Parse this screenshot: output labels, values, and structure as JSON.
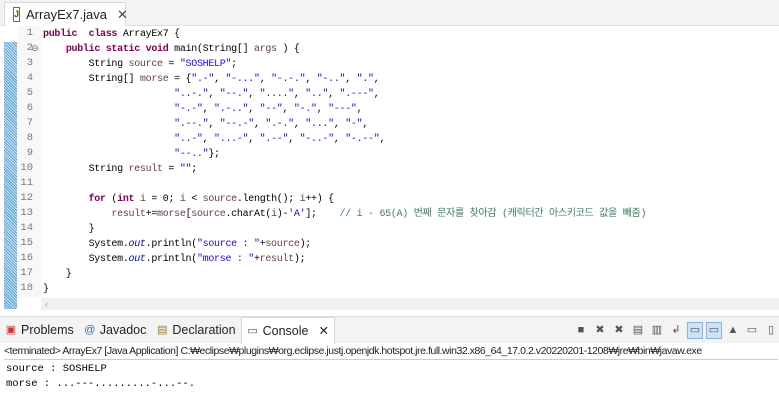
{
  "editor_tab": {
    "title": "ArrayEx7.java",
    "close": "✕"
  },
  "code_lines": [
    [
      [
        "kw",
        "public"
      ],
      [
        "",
        "  "
      ],
      [
        "kw",
        "class"
      ],
      [
        "",
        " ArrayEx7 {"
      ]
    ],
    [
      [
        "",
        "    "
      ],
      [
        "kw",
        "public"
      ],
      [
        "",
        " "
      ],
      [
        "kw",
        "static"
      ],
      [
        "",
        " "
      ],
      [
        "kw",
        "void"
      ],
      [
        "",
        " main(String[] "
      ],
      [
        "var",
        "args"
      ],
      [
        "",
        " ) {"
      ]
    ],
    [
      [
        "",
        "        String "
      ],
      [
        "var",
        "source"
      ],
      [
        "",
        " = "
      ],
      [
        "str",
        "\"SOSHELP\""
      ],
      [
        "",
        ";"
      ]
    ],
    [
      [
        "",
        "        String[] "
      ],
      [
        "var",
        "morse"
      ],
      [
        "",
        " = {"
      ],
      [
        "str",
        "\".-\""
      ],
      [
        "",
        ", "
      ],
      [
        "str",
        "\"-...\""
      ],
      [
        "",
        ", "
      ],
      [
        "str",
        "\"-.-.\""
      ],
      [
        "",
        ", "
      ],
      [
        "str",
        "\"-..\""
      ],
      [
        "",
        ", "
      ],
      [
        "str",
        "\".\""
      ],
      [
        "",
        ","
      ]
    ],
    [
      [
        "",
        "                       "
      ],
      [
        "str",
        "\"..-.\""
      ],
      [
        "",
        ", "
      ],
      [
        "str",
        "\"--.\""
      ],
      [
        "",
        ", "
      ],
      [
        "str",
        "\"....\""
      ],
      [
        "",
        ", "
      ],
      [
        "str",
        "\"..\""
      ],
      [
        "",
        ", "
      ],
      [
        "str",
        "\".---\""
      ],
      [
        "",
        ","
      ]
    ],
    [
      [
        "",
        "                       "
      ],
      [
        "str",
        "\"-.-\""
      ],
      [
        "",
        ", "
      ],
      [
        "str",
        "\".-..\""
      ],
      [
        "",
        ", "
      ],
      [
        "str",
        "\"--\""
      ],
      [
        "",
        ", "
      ],
      [
        "str",
        "\"-.\""
      ],
      [
        "",
        ", "
      ],
      [
        "str",
        "\"---\""
      ],
      [
        "",
        ","
      ]
    ],
    [
      [
        "",
        "                       "
      ],
      [
        "str",
        "\".--.\""
      ],
      [
        "",
        ", "
      ],
      [
        "str",
        "\"--.-\""
      ],
      [
        "",
        ", "
      ],
      [
        "str",
        "\".-.\""
      ],
      [
        "",
        ", "
      ],
      [
        "str",
        "\"...\""
      ],
      [
        "",
        ", "
      ],
      [
        "str",
        "\"-\""
      ],
      [
        "",
        ","
      ]
    ],
    [
      [
        "",
        "                       "
      ],
      [
        "str",
        "\"..-\""
      ],
      [
        "",
        ", "
      ],
      [
        "str",
        "\"...-\""
      ],
      [
        "",
        ", "
      ],
      [
        "str",
        "\".--\""
      ],
      [
        "",
        ", "
      ],
      [
        "str",
        "\"-..-\""
      ],
      [
        "",
        ", "
      ],
      [
        "str",
        "\"-.--\""
      ],
      [
        "",
        ","
      ]
    ],
    [
      [
        "",
        "                       "
      ],
      [
        "str",
        "\"--..\""
      ],
      [
        "",
        "};"
      ]
    ],
    [
      [
        "",
        "        String "
      ],
      [
        "var",
        "result"
      ],
      [
        "",
        " = "
      ],
      [
        "str",
        "\"\""
      ],
      [
        "",
        ";"
      ]
    ],
    [
      [
        "",
        ""
      ]
    ],
    [
      [
        "",
        "        "
      ],
      [
        "kw",
        "for"
      ],
      [
        "",
        " ("
      ],
      [
        "kw",
        "int"
      ],
      [
        "",
        " "
      ],
      [
        "var",
        "i"
      ],
      [
        "",
        " = 0; "
      ],
      [
        "var",
        "i"
      ],
      [
        "",
        " < "
      ],
      [
        "var",
        "source"
      ],
      [
        "",
        ".length(); "
      ],
      [
        "var",
        "i"
      ],
      [
        "",
        "++) {"
      ]
    ],
    [
      [
        "",
        "            "
      ],
      [
        "var",
        "result"
      ],
      [
        "",
        "+="
      ],
      [
        "var",
        "morse"
      ],
      [
        "",
        "["
      ],
      [
        "var",
        "source"
      ],
      [
        "",
        ".charAt("
      ],
      [
        "var",
        "i"
      ],
      [
        "",
        ")-"
      ],
      [
        "str",
        "'A'"
      ],
      [
        "",
        "];    "
      ],
      [
        "cmt",
        "// i - 65(A) 번째 문자를 찾아감 (캐릭터간 아스키코드 값을 빼줌)"
      ]
    ],
    [
      [
        "",
        "        }"
      ]
    ],
    [
      [
        "",
        "        System."
      ],
      [
        "fld",
        "out"
      ],
      [
        "",
        ".println("
      ],
      [
        "str",
        "\"source : \""
      ],
      [
        "",
        "+"
      ],
      [
        "var",
        "source"
      ],
      [
        "",
        ");"
      ]
    ],
    [
      [
        "",
        "        System."
      ],
      [
        "fld",
        "out"
      ],
      [
        "",
        ".println("
      ],
      [
        "str",
        "\"morse : \""
      ],
      [
        "",
        "+"
      ],
      [
        "var",
        "result"
      ],
      [
        "",
        ");"
      ]
    ],
    [
      [
        "",
        "    }"
      ]
    ],
    [
      [
        "",
        "}"
      ]
    ]
  ],
  "panel": {
    "tabs": [
      {
        "label": "Problems",
        "icon": "problems-icon"
      },
      {
        "label": "Javadoc",
        "icon": "javadoc-icon"
      },
      {
        "label": "Declaration",
        "icon": "declaration-icon"
      },
      {
        "label": "Console",
        "icon": "console-icon",
        "active": true
      }
    ],
    "console_close": "✕",
    "status": "<terminated> ArrayEx7 [Java Application] C:₩eclipse₩plugins₩org.eclipse.justj.openjdk.hotspot.jre.full.win32.x86_64_17.0.2.v20220201-1208₩jre₩bin₩javaw.exe",
    "output": [
      "source : SOSHELP",
      "morse : ...---.........-...--."
    ]
  },
  "colors": {
    "keyword": "#7f0055",
    "string": "#2a00ff",
    "comment": "#3f7f5f"
  }
}
